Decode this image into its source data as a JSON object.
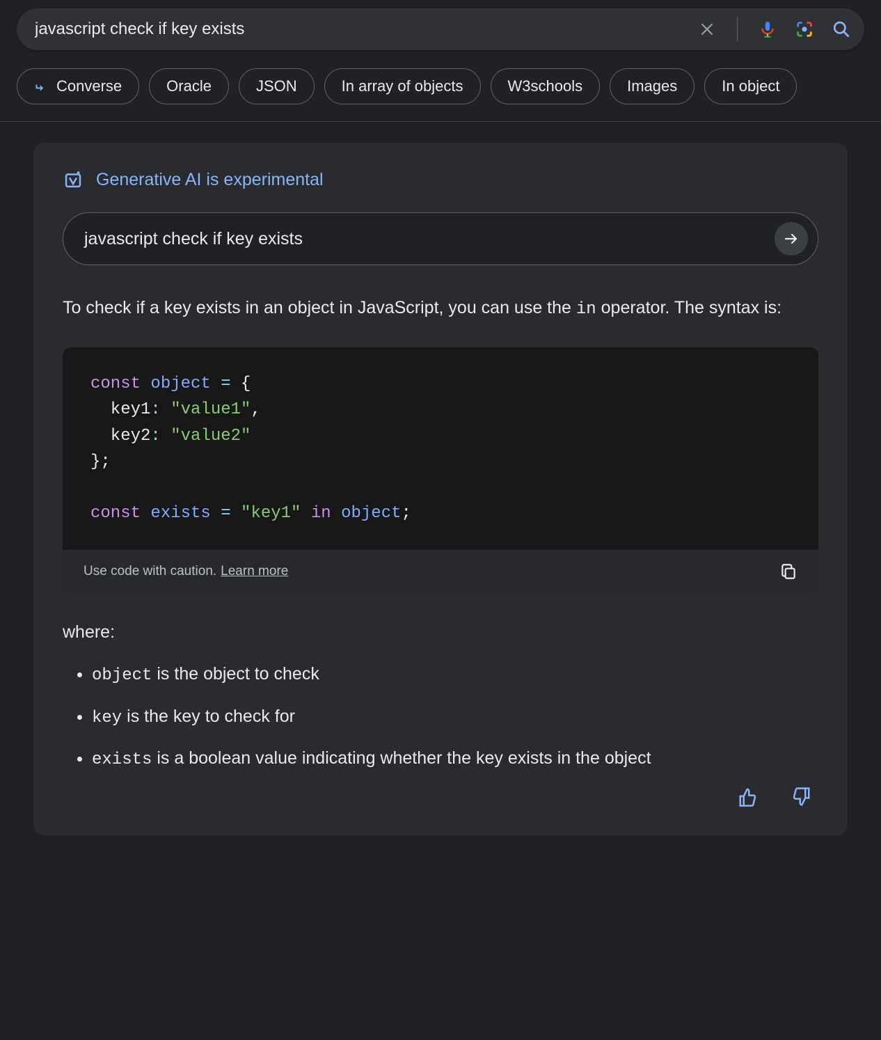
{
  "search": {
    "query": "javascript check if key exists"
  },
  "chips": [
    "Converse",
    "Oracle",
    "JSON",
    "In array of objects",
    "W3schools",
    "Images",
    "In object"
  ],
  "ai": {
    "badge": "Generative AI is experimental",
    "inner_query": "javascript check if key exists",
    "intro_pre": "To check if a key exists in an object in JavaScript, you can use the ",
    "intro_code": "in",
    "intro_post": " operator. The syntax is:",
    "code": {
      "l1_const": "const",
      "l1_obj": " object ",
      "l1_eq": "= ",
      "l1_brace": "{",
      "l2_key": "  key1",
      "l2_colon": ": ",
      "l2_str": "\"value1\"",
      "l2_comma": ",",
      "l3_key": "  key2",
      "l3_colon": ": ",
      "l3_str": "\"value2\"",
      "l4_close": "};",
      "l6_const": "const",
      "l6_exists": " exists ",
      "l6_eq": "= ",
      "l6_str": "\"key1\"",
      "l6_in": " in ",
      "l6_obj": "object",
      "l6_semi": ";"
    },
    "caution": "Use code with caution.",
    "learn_more": "Learn more",
    "where_label": "where:",
    "bullets": [
      {
        "code": "object",
        "text": " is the object to check"
      },
      {
        "code": "key",
        "text": " is the key to check for"
      },
      {
        "code": "exists",
        "text": " is a boolean value indicating whether the key exists in the object"
      }
    ]
  }
}
